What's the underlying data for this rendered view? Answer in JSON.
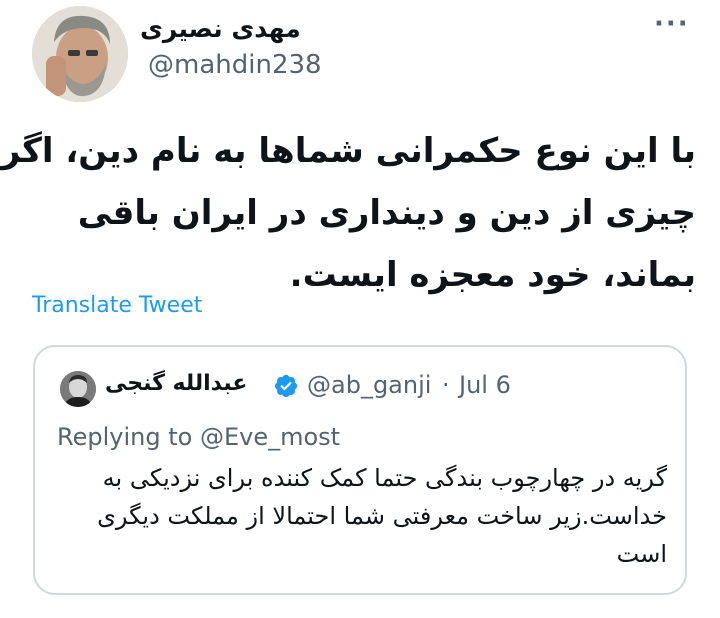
{
  "tweet": {
    "author_name": "مهدی نصیری",
    "author_handle": "@mahdin238",
    "more_label": "···",
    "text_lines": [
      "با این نوع حکمرانی شماها به نام دین، اگر",
      "چیزی از دین و دینداری در ایران باقی",
      "بماند، خود معجزه ایست."
    ],
    "translate_label": "Translate Tweet"
  },
  "quoted": {
    "author_name": "عبدالله گنجی",
    "author_handle": "@ab_ganji",
    "separator": "·",
    "date": "Jul 6",
    "replying_to_prefix": "Replying to",
    "replying_to_handle": "@Eve_most",
    "text_lines": [
      "گریه در چهارچوب بندگی حتما کمک کننده برای نزدیکی به",
      "خداست.زیر ساخت معرفتی شما احتمالا از مملکت دیگری",
      "است"
    ]
  },
  "colors": {
    "text": "#0f1419",
    "secondary": "#536471",
    "link": "#1d9bf0",
    "border": "#cfd9de",
    "verified": "#1d9bf0"
  }
}
